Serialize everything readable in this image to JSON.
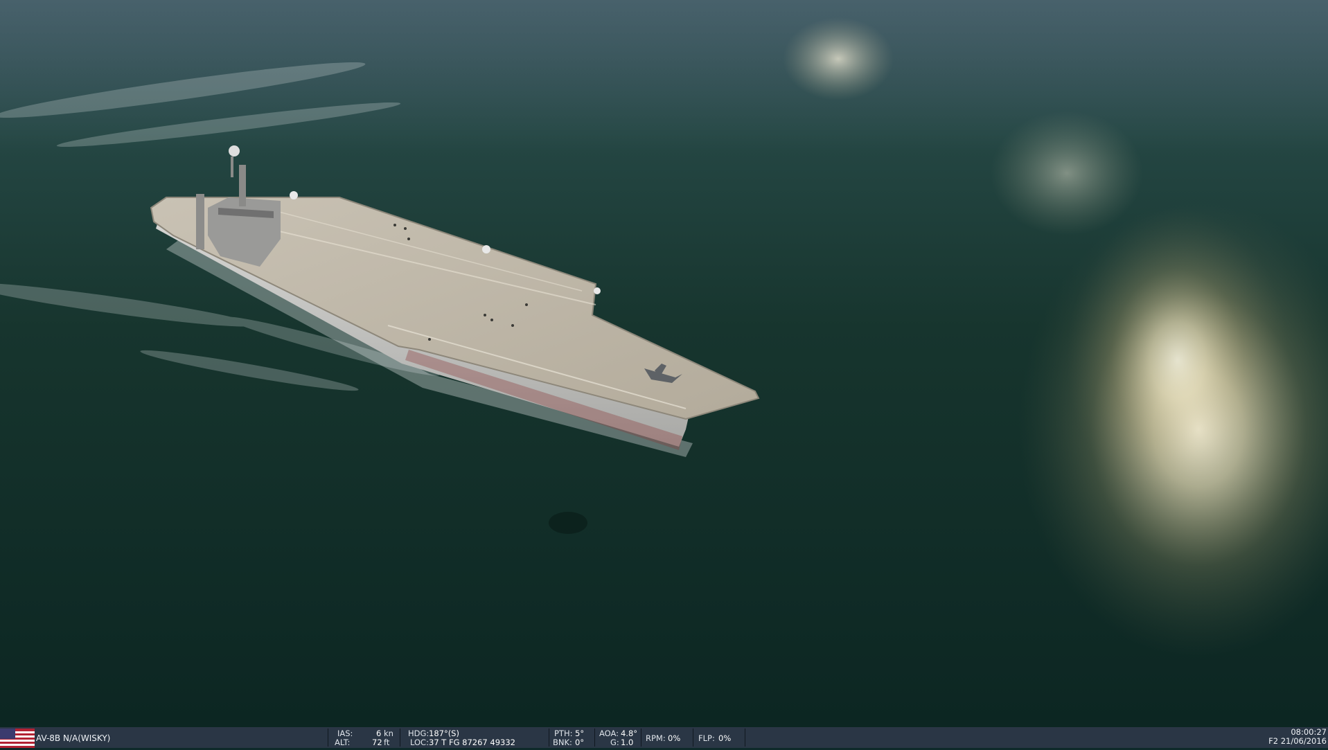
{
  "unit": {
    "name": "AV-8B N/A(WISKY)",
    "coalition_flag": "usa-flag-icon"
  },
  "telemetry": {
    "ias_label": "IAS:",
    "ias_value": "6",
    "ias_unit": "kn",
    "alt_label": "ALT:",
    "alt_value": "72",
    "alt_unit": "ft",
    "hdg_label": "HDG:",
    "hdg_value": "187°(S)",
    "loc_label": "LOC:",
    "loc_value": "37 T FG 87267 49332",
    "pth_label": "PTH:",
    "pth_value": "5°",
    "bnk_label": "BNK:",
    "bnk_value": "0°",
    "aoa_label": "AOA:",
    "aoa_value": "4.8°",
    "g_label": "G:",
    "g_value": "1.0",
    "rpm_label": "RPM:",
    "rpm_value": "0%",
    "flp_label": "FLP:",
    "flp_value": "0%"
  },
  "clock": {
    "time": "08:00:27",
    "date": "F2 21/06/2016"
  },
  "colors": {
    "statusbar_bg": "#2a3645",
    "sea_dark": "#0f2a24",
    "sun_glare": "#f4ecd2"
  }
}
